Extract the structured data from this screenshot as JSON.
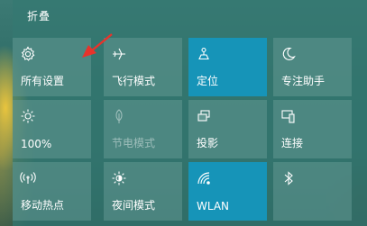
{
  "header": {
    "collapse_label": "折叠"
  },
  "tiles": [
    {
      "label": "所有设置",
      "icon": "gear-icon",
      "state": "off"
    },
    {
      "label": "飞行模式",
      "icon": "airplane-icon",
      "state": "off"
    },
    {
      "label": "定位",
      "icon": "location-icon",
      "state": "on"
    },
    {
      "label": "专注助手",
      "icon": "moon-icon",
      "state": "off"
    },
    {
      "label": "100%",
      "icon": "brightness-icon",
      "state": "off"
    },
    {
      "label": "节电模式",
      "icon": "battery-saver-icon",
      "state": "disabled"
    },
    {
      "label": "投影",
      "icon": "project-icon",
      "state": "off"
    },
    {
      "label": "连接",
      "icon": "connect-icon",
      "state": "off"
    },
    {
      "label": "移动热点",
      "icon": "hotspot-icon",
      "state": "off"
    },
    {
      "label": "夜间模式",
      "icon": "night-light-icon",
      "state": "off"
    },
    {
      "label": "WLAN",
      "icon": "wifi-icon",
      "state": "on"
    },
    {
      "label": "",
      "icon": "bluetooth-icon",
      "state": "off"
    }
  ],
  "colors": {
    "active_tile": "#1694b8",
    "annotation_arrow": "#e8332b"
  }
}
